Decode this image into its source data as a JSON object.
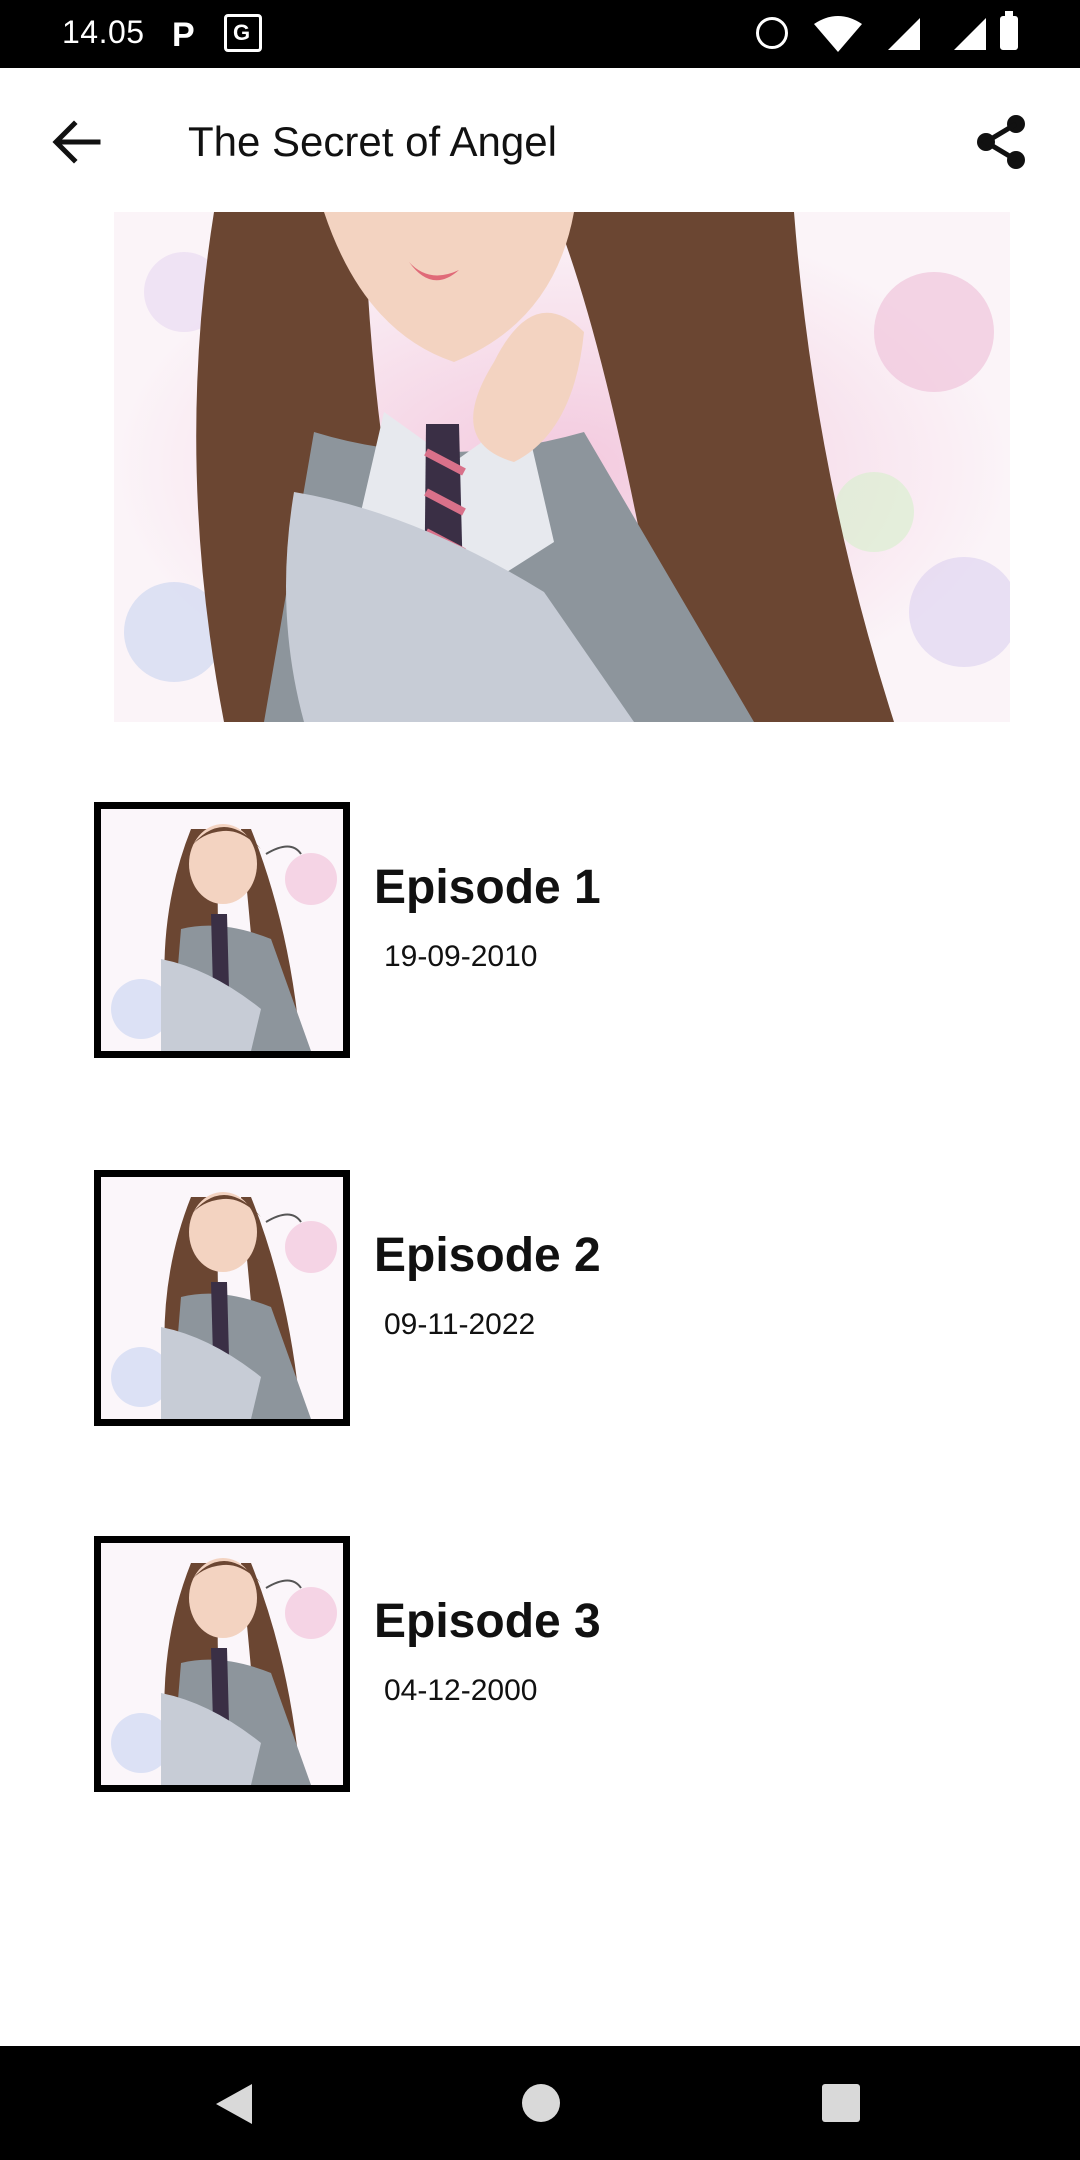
{
  "status_bar": {
    "time": "14.05",
    "icons": [
      "parking-icon",
      "translate-icon",
      "alarm-icon",
      "wifi-icon",
      "signal-icon",
      "signal-icon",
      "battery-icon"
    ]
  },
  "app_bar": {
    "title": "The Secret of Angel",
    "back_icon": "arrow-left-icon",
    "share_icon": "share-icon"
  },
  "episodes": [
    {
      "title": "Episode 1",
      "date": "19-09-2010"
    },
    {
      "title": "Episode 2",
      "date": "09-11-2022"
    },
    {
      "title": "Episode 3",
      "date": "04-12-2000"
    }
  ],
  "nav_bar": {
    "icons": [
      "nav-back-icon",
      "nav-home-icon",
      "nav-recents-icon"
    ]
  }
}
